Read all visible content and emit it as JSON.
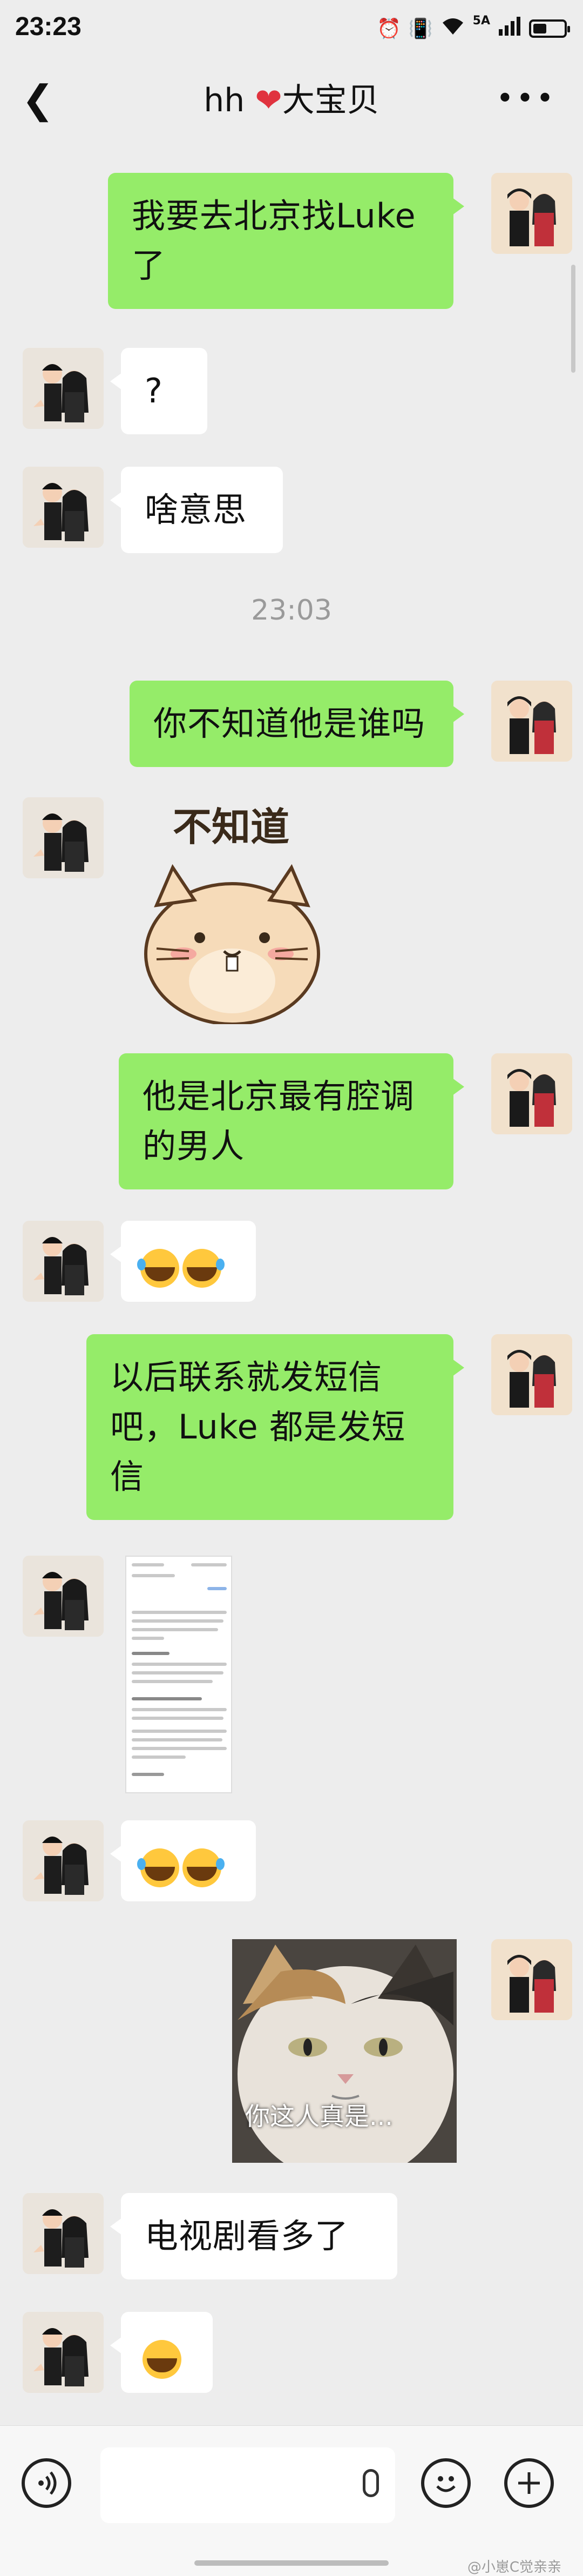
{
  "status_bar": {
    "time": "23:23",
    "signal_label": "5A",
    "icons": [
      "alarm-icon",
      "vibrate-icon",
      "wifi-icon",
      "signal-icon",
      "battery-icon"
    ]
  },
  "nav": {
    "back_icon": "chevron-left-icon",
    "title_prefix": "hh ",
    "title_heart": "❤",
    "title_suffix": "大宝贝",
    "more_icon": "more-icon",
    "more_glyph": "•••"
  },
  "messages": [
    {
      "from": "me",
      "type": "text",
      "text": "我要去北京找Luke了"
    },
    {
      "from": "other",
      "type": "text",
      "text": "?"
    },
    {
      "from": "other",
      "type": "text",
      "text": "啥意思"
    },
    {
      "type": "timestamp",
      "text": "23:03"
    },
    {
      "from": "me",
      "type": "text",
      "text": "你不知道他是谁吗"
    },
    {
      "from": "other",
      "type": "sticker",
      "text": "不知道"
    },
    {
      "from": "me",
      "type": "text",
      "text": "他是北京最有腔调的男人"
    },
    {
      "from": "other",
      "type": "emoji",
      "emoji": [
        "laugh-cry-icon",
        "laugh-cry-icon"
      ]
    },
    {
      "from": "me",
      "type": "text",
      "text": "以后联系就发短信吧，Luke 都是发短信"
    },
    {
      "from": "other",
      "type": "image",
      "description": "screenshot"
    },
    {
      "from": "other",
      "type": "emoji",
      "emoji": [
        "laugh-cry-icon",
        "laugh-cry-icon"
      ]
    },
    {
      "from": "me",
      "type": "image",
      "text": "你这人真是..."
    },
    {
      "from": "other",
      "type": "text",
      "text": "电视剧看多了"
    },
    {
      "from": "other",
      "type": "emoji",
      "emoji": [
        "grin-icon"
      ]
    }
  ],
  "input_bar": {
    "voice_icon": "voice-icon",
    "mic_icon": "mic-icon",
    "emoji_icon": "emoji-icon",
    "plus_icon": "plus-icon"
  },
  "watermark": "@小崽C觉亲亲",
  "colors": {
    "background": "#ededed",
    "my_bubble": "#95ec69",
    "their_bubble": "#ffffff",
    "heart": "#e0333f"
  }
}
